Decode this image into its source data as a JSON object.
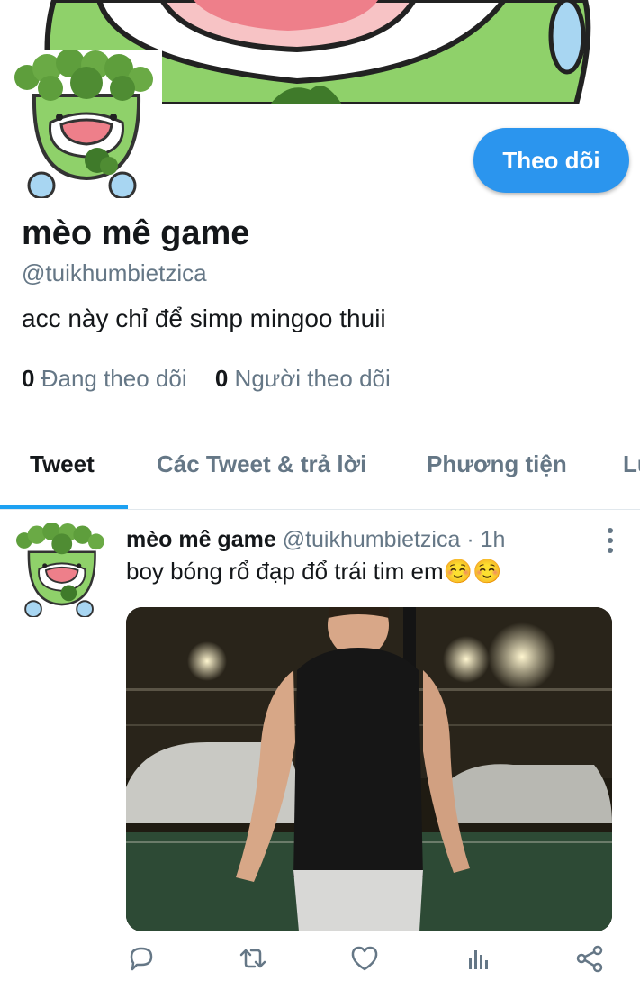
{
  "profile": {
    "display_name": "mèo mê game",
    "handle": "@tuikhumbietzica",
    "bio": "acc này chỉ để simp mingoo thuii",
    "follow_label": "Theo dõi",
    "following_count": "0",
    "following_label": "Đang theo dõi",
    "followers_count": "0",
    "followers_label": "Người theo dõi"
  },
  "tabs": [
    {
      "label": "Tweet",
      "active": true
    },
    {
      "label": "Các Tweet & trả lời",
      "active": false
    },
    {
      "label": "Phương tiện",
      "active": false
    },
    {
      "label": "Lượt thích",
      "active": false
    }
  ],
  "tweet": {
    "author_name": "mèo mê game",
    "author_meta": "@tuikhumbietzica · 1h",
    "text": "boy bóng rổ đạp đổ trái tim em☺️☺️"
  },
  "icons": {
    "reply": "reply-icon",
    "retweet": "retweet-icon",
    "like": "heart-icon",
    "analytics": "analytics-icon",
    "share": "share-icon",
    "menu": "more-vertical-icon"
  },
  "colors": {
    "accent": "#1da1f2",
    "follow_button": "#2b95ee",
    "secondary_text": "#657786",
    "avatar_green": "#8fd16a"
  }
}
